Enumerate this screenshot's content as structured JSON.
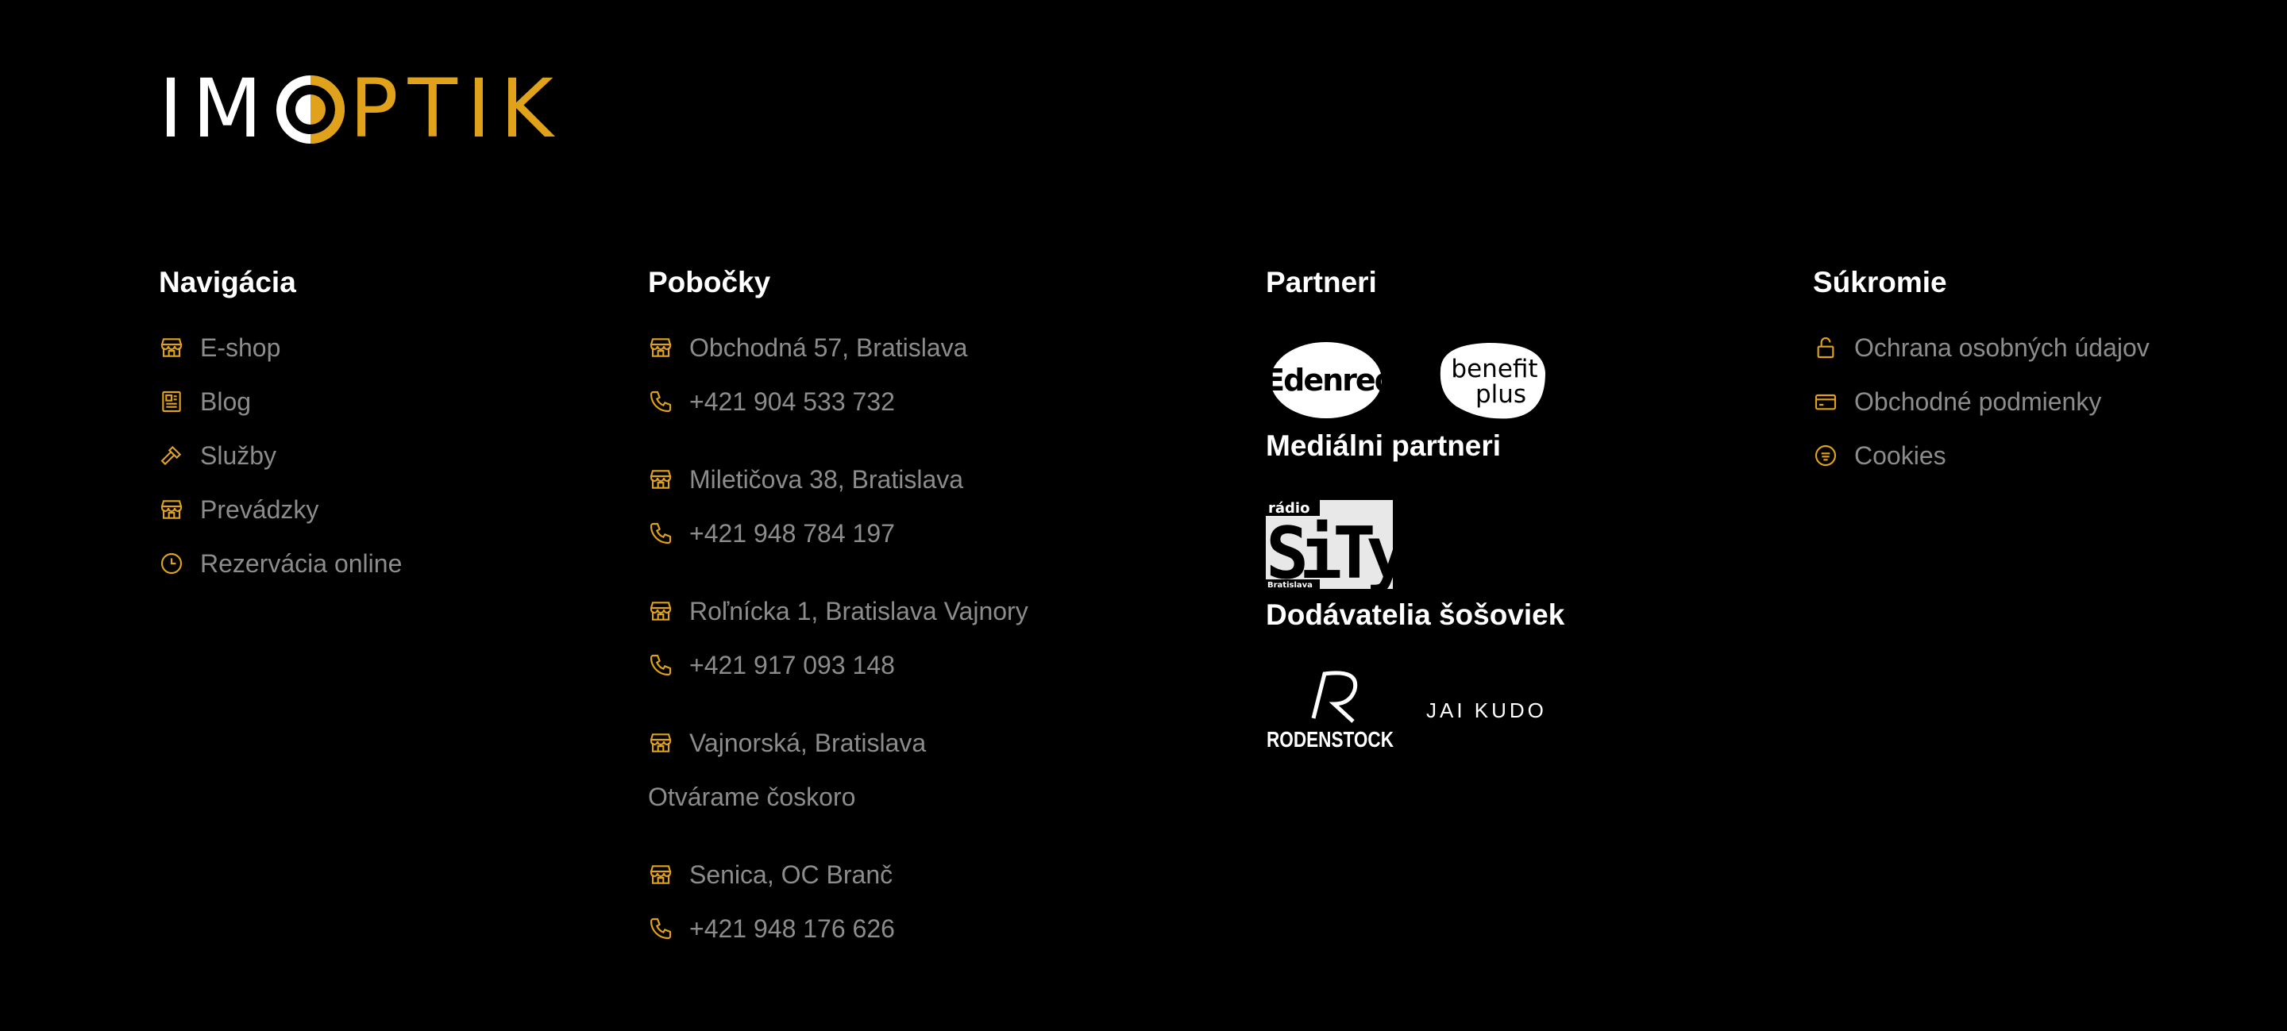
{
  "brand": {
    "logo_text": "IMOPTIK",
    "accent": "#e0a21a"
  },
  "navigation": {
    "title": "Navigácia",
    "items": [
      {
        "label": "E-shop",
        "icon": "store-icon"
      },
      {
        "label": "Blog",
        "icon": "newspaper-icon"
      },
      {
        "label": "Služby",
        "icon": "hammer-icon"
      },
      {
        "label": "Prevádzky",
        "icon": "store-icon"
      },
      {
        "label": "Rezervácia online",
        "icon": "clock-icon"
      }
    ]
  },
  "branches": {
    "title": "Pobočky",
    "items": [
      {
        "address": "Obchodná 57, Bratislava",
        "phone": "+421 904 533 732"
      },
      {
        "address": "Miletičova 38, Bratislava",
        "phone": "+421 948 784 197"
      },
      {
        "address": "Roľnícka 1, Bratislava Vajnory",
        "phone": "+421 917 093 148"
      },
      {
        "address": "Vajnorská, Bratislava",
        "note": "Otvárame čoskoro"
      },
      {
        "address": "Senica, OC Branč",
        "phone": "+421 948 176 626"
      }
    ]
  },
  "partners": {
    "title": "Partneri",
    "logos": [
      "Edenred",
      "benefit plus"
    ],
    "media_title": "Mediálni partneri",
    "media_logo": {
      "top": "rádio",
      "main": "SiTy",
      "bottom": "Bratislava"
    },
    "suppliers_title": "Dodávatelia šošoviek",
    "suppliers": [
      "RODENSTOCK",
      "JAI KUDO"
    ]
  },
  "privacy": {
    "title": "Súkromie",
    "items": [
      {
        "label": "Ochrana osobných údajov",
        "icon": "lock-icon"
      },
      {
        "label": "Obchodné podmienky",
        "icon": "credit-card-icon"
      },
      {
        "label": "Cookies",
        "icon": "cookie-icon"
      }
    ]
  }
}
